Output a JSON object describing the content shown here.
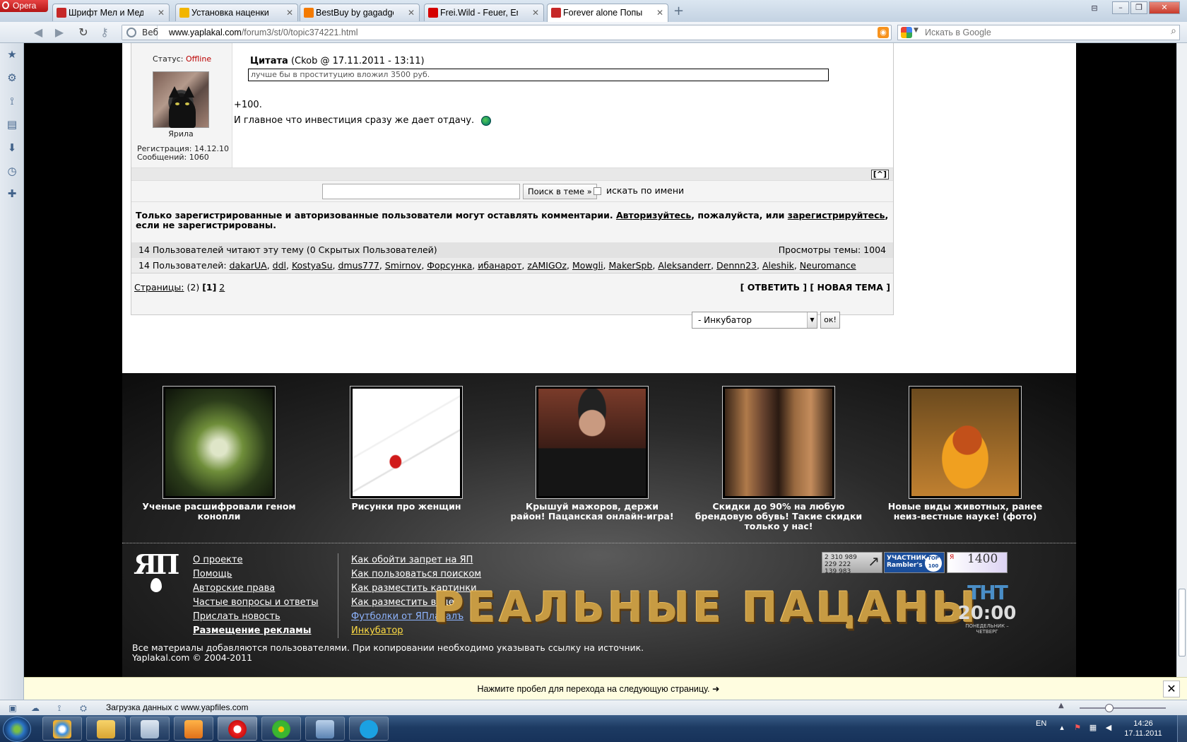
{
  "browser": {
    "menu_label": "Opera",
    "tabs": [
      {
        "title": "Шрифт Мел и Мед",
        "favicon_color": "#c62828",
        "active": false
      },
      {
        "title": "Установка наценки в з...",
        "favicon_color": "#f2b500",
        "active": false
      },
      {
        "title": "BestBuy by gagadget.c...",
        "favicon_color": "#f47a00",
        "active": false
      },
      {
        "title": "Frei.Wild - Feuer, Erde, ...",
        "favicon_color": "#d50000",
        "active": false
      },
      {
        "title": "Forever alone Попытк...",
        "favicon_color": "#c62828",
        "active": true
      }
    ],
    "address": {
      "web_label": "Веб",
      "url_host": "www.yaplakal.com",
      "url_path": "/forum3/st/0/topic374221.html"
    },
    "search": {
      "placeholder": "Искать в Google"
    },
    "hint": "Нажмите пробел для перехода на следующую страницу.",
    "status_text": "Загрузка данных с www.yapfiles.com"
  },
  "post": {
    "status_label": "Статус:",
    "status_value": "Offline",
    "nickname": "Ярила",
    "registration": "Регистрация: 14.12.10",
    "messages": "Сообщений: 1060",
    "quote_label": "Цитата",
    "quote_meta": "(Ckob @ 17.11.2011 - 13:11)",
    "quote_text": "лучше бы в проституцию вложил 3500 руб.",
    "line1": "+100.",
    "line2": "И главное что инвестиция сразу же дает отдачу.",
    "to_top": "[^]"
  },
  "topic_search": {
    "button": "Поиск в теме »",
    "by_name_label": "искать по имени"
  },
  "notice": {
    "part1": "Только зарегистрированные и авторизованные пользователи могут оставлять комментарии.",
    "login_link": "Авторизуйтесь",
    "part2": ", пожалуйста, или",
    "register_link": "зарегистрируйтесь",
    "part3": ", если не зарегистрированы."
  },
  "readers": {
    "summary": "14 Пользователей читают эту тему (0 Скрытых Пользователей)",
    "views": "Просмотры темы: 1004",
    "users_label": "14 Пользователей:",
    "users": [
      "dakarUA",
      "ddl",
      "KostyaSu",
      "dmus777",
      "Smirnov",
      "Форсунка",
      "ибанарот",
      "zAMIGOz",
      "Mowgli",
      "MakerSpb",
      "Aleksanderr",
      "Dennn23",
      "Aleshik",
      "Neuromance"
    ]
  },
  "pagination": {
    "pages_link": "Страницы:",
    "count": "(2)",
    "current": "[1]",
    "next": "2",
    "actions": "[ ОТВЕТИТЬ ] [ НОВАЯ ТЕМА ]"
  },
  "jump": {
    "selected": "- Инкубатор",
    "ok": "ок!"
  },
  "promos": [
    {
      "caption": "Ученые расшифровали геном конопли"
    },
    {
      "caption": "Рисунки про женщин"
    },
    {
      "caption": "Крышуй мажоров, держи район! Пацанская онлайн-игра!"
    },
    {
      "caption": "Скидки до 90% на любую брендовую обувь! Такие скидки только у нас!"
    },
    {
      "caption": "Новые виды животных, ранее неиз-вестные науке! (фото)"
    }
  ],
  "footer": {
    "logo": "ЯП",
    "col1": [
      "О проекте",
      "Помощь",
      "Авторские права",
      "Частые вопросы и ответы",
      "Прислать новость",
      "Размещение рекламы"
    ],
    "col2": [
      "Как обойти запрет на ЯП",
      "Как пользоваться поиском",
      "Как разместить картинки",
      "Как разместить видео",
      "Футболки от ЯПлакалъ",
      "Инкубатор"
    ],
    "copyright1": "Все материалы добавляются пользователями. При копировании необходимо указывать ссылку на источник.",
    "copyright2": "Yaplakal.com © 2004-2011",
    "banner_title": "РЕАЛЬНЫЕ ПАЦАНЫ",
    "banner_channel": "ТНТ",
    "banner_time": "20:00",
    "banner_days": "ПОНЕДЕЛЬНИК – ЧЕТВЕРГ",
    "counter1": [
      "2 310 989",
      "229 222",
      "139 983"
    ],
    "counter2": [
      "УЧАСТНИК",
      "Rambler's"
    ],
    "counter2_badge": "TOP 100",
    "counter3_letter": "Я",
    "counter3_num": "1400"
  },
  "taskbar": {
    "lang": "EN",
    "time": "14:26",
    "date": "17.11.2011"
  }
}
